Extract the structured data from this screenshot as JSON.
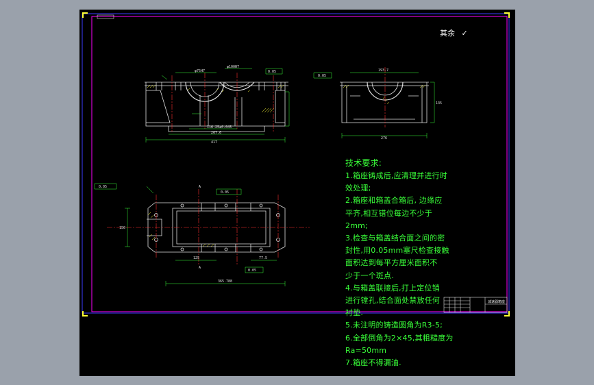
{
  "colors": {
    "canvas": "#000000",
    "frame_background": "#9aa1ab",
    "border_outer": "#3b3bff",
    "border_inner": "#ff00ff",
    "geometry": "#ffffff",
    "dimension": "#39ff39",
    "centerline": "#ff3030",
    "hatch": "#ffff33",
    "text_green": "#39ff39"
  },
  "roughness_note": {
    "label": "其余",
    "symbol": "✓"
  },
  "dimensions": {
    "front_overall_length": "417",
    "front_inner_length": "267.6",
    "front_center_distance": "116.25±0.045",
    "front_height": "95",
    "front_bore_diameter": "φ100H7",
    "front_small_bore": "φ75H7",
    "side_overall_width": "276",
    "side_top_width": "193.7",
    "side_height": "135",
    "top_overall_length": "365.788",
    "top_dim_left": "125",
    "top_dim_right": "77.5",
    "top_width": "150",
    "section_mark": "A",
    "tolerance_box": "0.05"
  },
  "technical_requirements": {
    "title": "技术要求:",
    "lines": [
      "1.箱座铸成后,应清理并进行时",
      "效处理;",
      "2.箱座和箱盖合箱后, 边缘应",
      "平齐,相互错位每边不少于",
      "2mm;",
      "3.检查与箱盖结合面之间的密",
      "封性,用0.05mm塞尺检查接触",
      "面积达到每平方厘米面积不",
      "少于一个斑点.",
      "4.与箱盖联接后,打上定位销",
      "进行镗孔,结合面处禁放任何",
      "衬垫.",
      "5.未注明的铸造圆角为R3-5;",
      "6.全部倒角为2×45,其粗糙度为",
      "Ra=50mm",
      "7.箱座不得漏油."
    ]
  },
  "title_block": {
    "name": "减速器箱座"
  }
}
